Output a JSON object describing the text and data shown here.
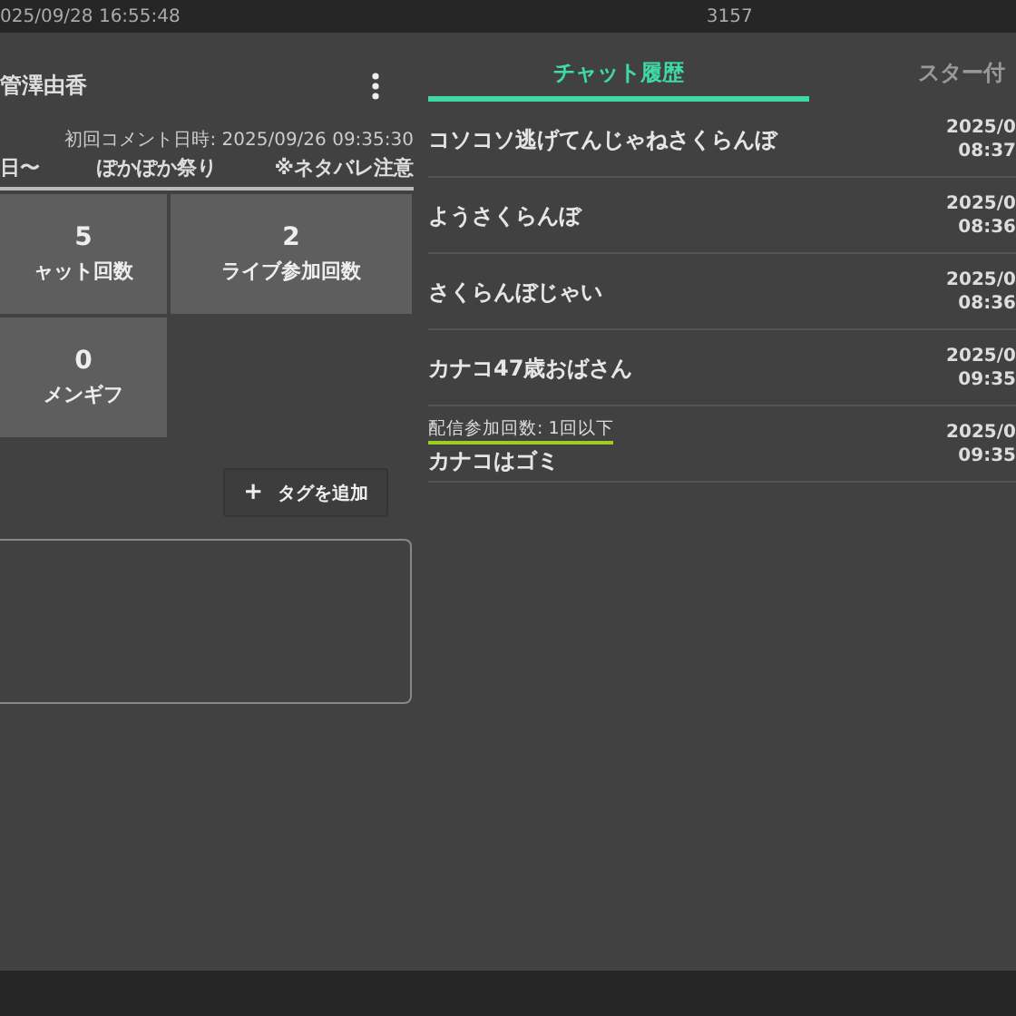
{
  "background_table": {
    "row": {
      "date": "025/09/28 16:55:48",
      "count": "3157"
    }
  },
  "profile": {
    "name": "管澤由香",
    "first_comment": "初回コメント日時: 2025/09/26 09:35:30",
    "tags": [
      "日〜",
      "ぽかぽか祭り",
      "※ネタバレ注意"
    ],
    "stats": [
      {
        "value": "5",
        "label": "ャット回数"
      },
      {
        "value": "2",
        "label": "ライブ参加回数"
      },
      {
        "value": "0",
        "label": "メンギフ"
      }
    ],
    "add_tag_button": {
      "icon": "+",
      "label": "タグを追加"
    }
  },
  "tabs": [
    {
      "label": "チャット履歴",
      "selected": true
    },
    {
      "label": "スター付",
      "selected": false
    }
  ],
  "chat_rows": [
    {
      "text": "コソコソ逃げてんじゃねさくらんぼ",
      "date": "2025/0",
      "time": "08:37"
    },
    {
      "text": "ようさくらんぼ",
      "date": "2025/0",
      "time": "08:36"
    },
    {
      "text": "さくらんぼじゃい",
      "date": "2025/0",
      "time": "08:36"
    },
    {
      "text": "カナコ47歳おばさん",
      "date": "2025/0",
      "time": "09:35"
    },
    {
      "text": "カナコはゴミ",
      "badge": "配信参加回数: 1回以下",
      "date": "2025/0",
      "time": "09:35"
    }
  ]
}
